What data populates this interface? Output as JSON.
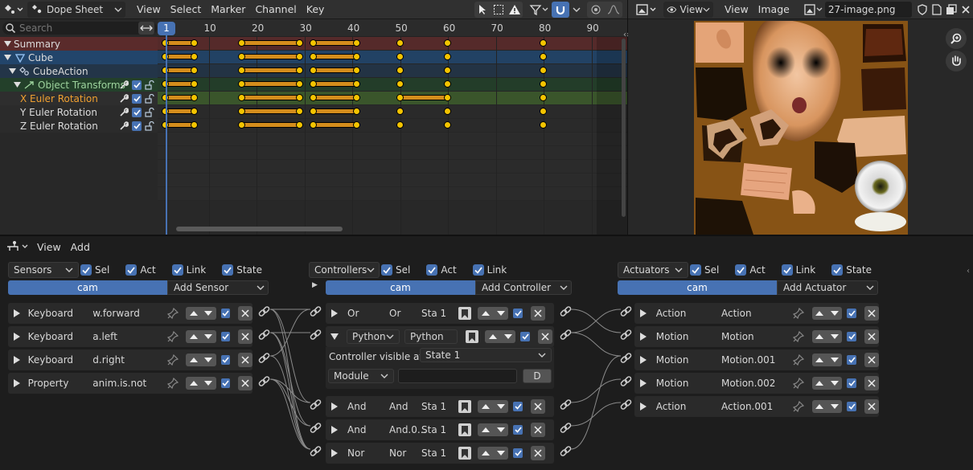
{
  "dopesheet": {
    "editor_type": "Dope Sheet",
    "menus": [
      "View",
      "Select",
      "Marker",
      "Channel",
      "Key"
    ],
    "search_placeholder": "Search",
    "current_frame": "1",
    "ruler_ticks": [
      "10",
      "20",
      "30",
      "40",
      "50",
      "60",
      "70",
      "80",
      "90"
    ],
    "channels": [
      {
        "label": "Summary",
        "kind": "summary"
      },
      {
        "label": "Cube",
        "kind": "object"
      },
      {
        "label": "CubeAction",
        "kind": "action"
      },
      {
        "label": "Object Transforms",
        "kind": "group"
      },
      {
        "label": "X Euler Rotation",
        "kind": "x"
      },
      {
        "label": "Y Euler Rotation",
        "kind": "fcurve"
      },
      {
        "label": "Z Euler Rotation",
        "kind": "fcurve"
      }
    ],
    "colors": {
      "summary": "#5a2b2b",
      "object": "#22456b",
      "action": "#233548",
      "group": "#23402a",
      "selected_row": "#3c5a2c",
      "key": "#f4c400",
      "hold": "#d48d1c",
      "frame_indicator": "#4772b3"
    }
  },
  "image_editor": {
    "menus": [
      "View",
      "View",
      "Image"
    ],
    "image_name": "27-image.png"
  },
  "logic": {
    "menus": [
      "View",
      "Add"
    ],
    "sensors": {
      "header": "Sensors",
      "toggles": [
        "Sel",
        "Act",
        "Link",
        "State"
      ],
      "object": "cam",
      "add": "Add Sensor",
      "items": [
        {
          "type": "Keyboard",
          "name": "w.forward"
        },
        {
          "type": "Keyboard",
          "name": "a.left"
        },
        {
          "type": "Keyboard",
          "name": "d.right"
        },
        {
          "type": "Property",
          "name": "anim.is.not"
        }
      ]
    },
    "controllers": {
      "header": "Controllers",
      "toggles": [
        "Sel",
        "Act",
        "Link"
      ],
      "object": "cam",
      "add": "Add Controller",
      "items": [
        {
          "type": "Or",
          "name": "Or",
          "state": "Sta 1"
        },
        {
          "type": "Python",
          "name": "Python",
          "expanded": true
        },
        {
          "type": "And",
          "name": "And",
          "state": "Sta 1"
        },
        {
          "type": "And",
          "name": "And.0...",
          "state": "Sta 1"
        },
        {
          "type": "Nor",
          "name": "Nor",
          "state": "Sta 1"
        }
      ],
      "python": {
        "visible_label": "Controller visible at:",
        "state": "State 1",
        "mode": "Module",
        "d_label": "D"
      }
    },
    "actuators": {
      "header": "Actuators",
      "toggles": [
        "Sel",
        "Act",
        "Link",
        "State"
      ],
      "object": "cam",
      "add": "Add Actuator",
      "items": [
        {
          "type": "Action",
          "name": "Action"
        },
        {
          "type": "Motion",
          "name": "Motion"
        },
        {
          "type": "Motion",
          "name": "Motion.001"
        },
        {
          "type": "Motion",
          "name": "Motion.002"
        },
        {
          "type": "Action",
          "name": "Action.001"
        }
      ]
    }
  }
}
